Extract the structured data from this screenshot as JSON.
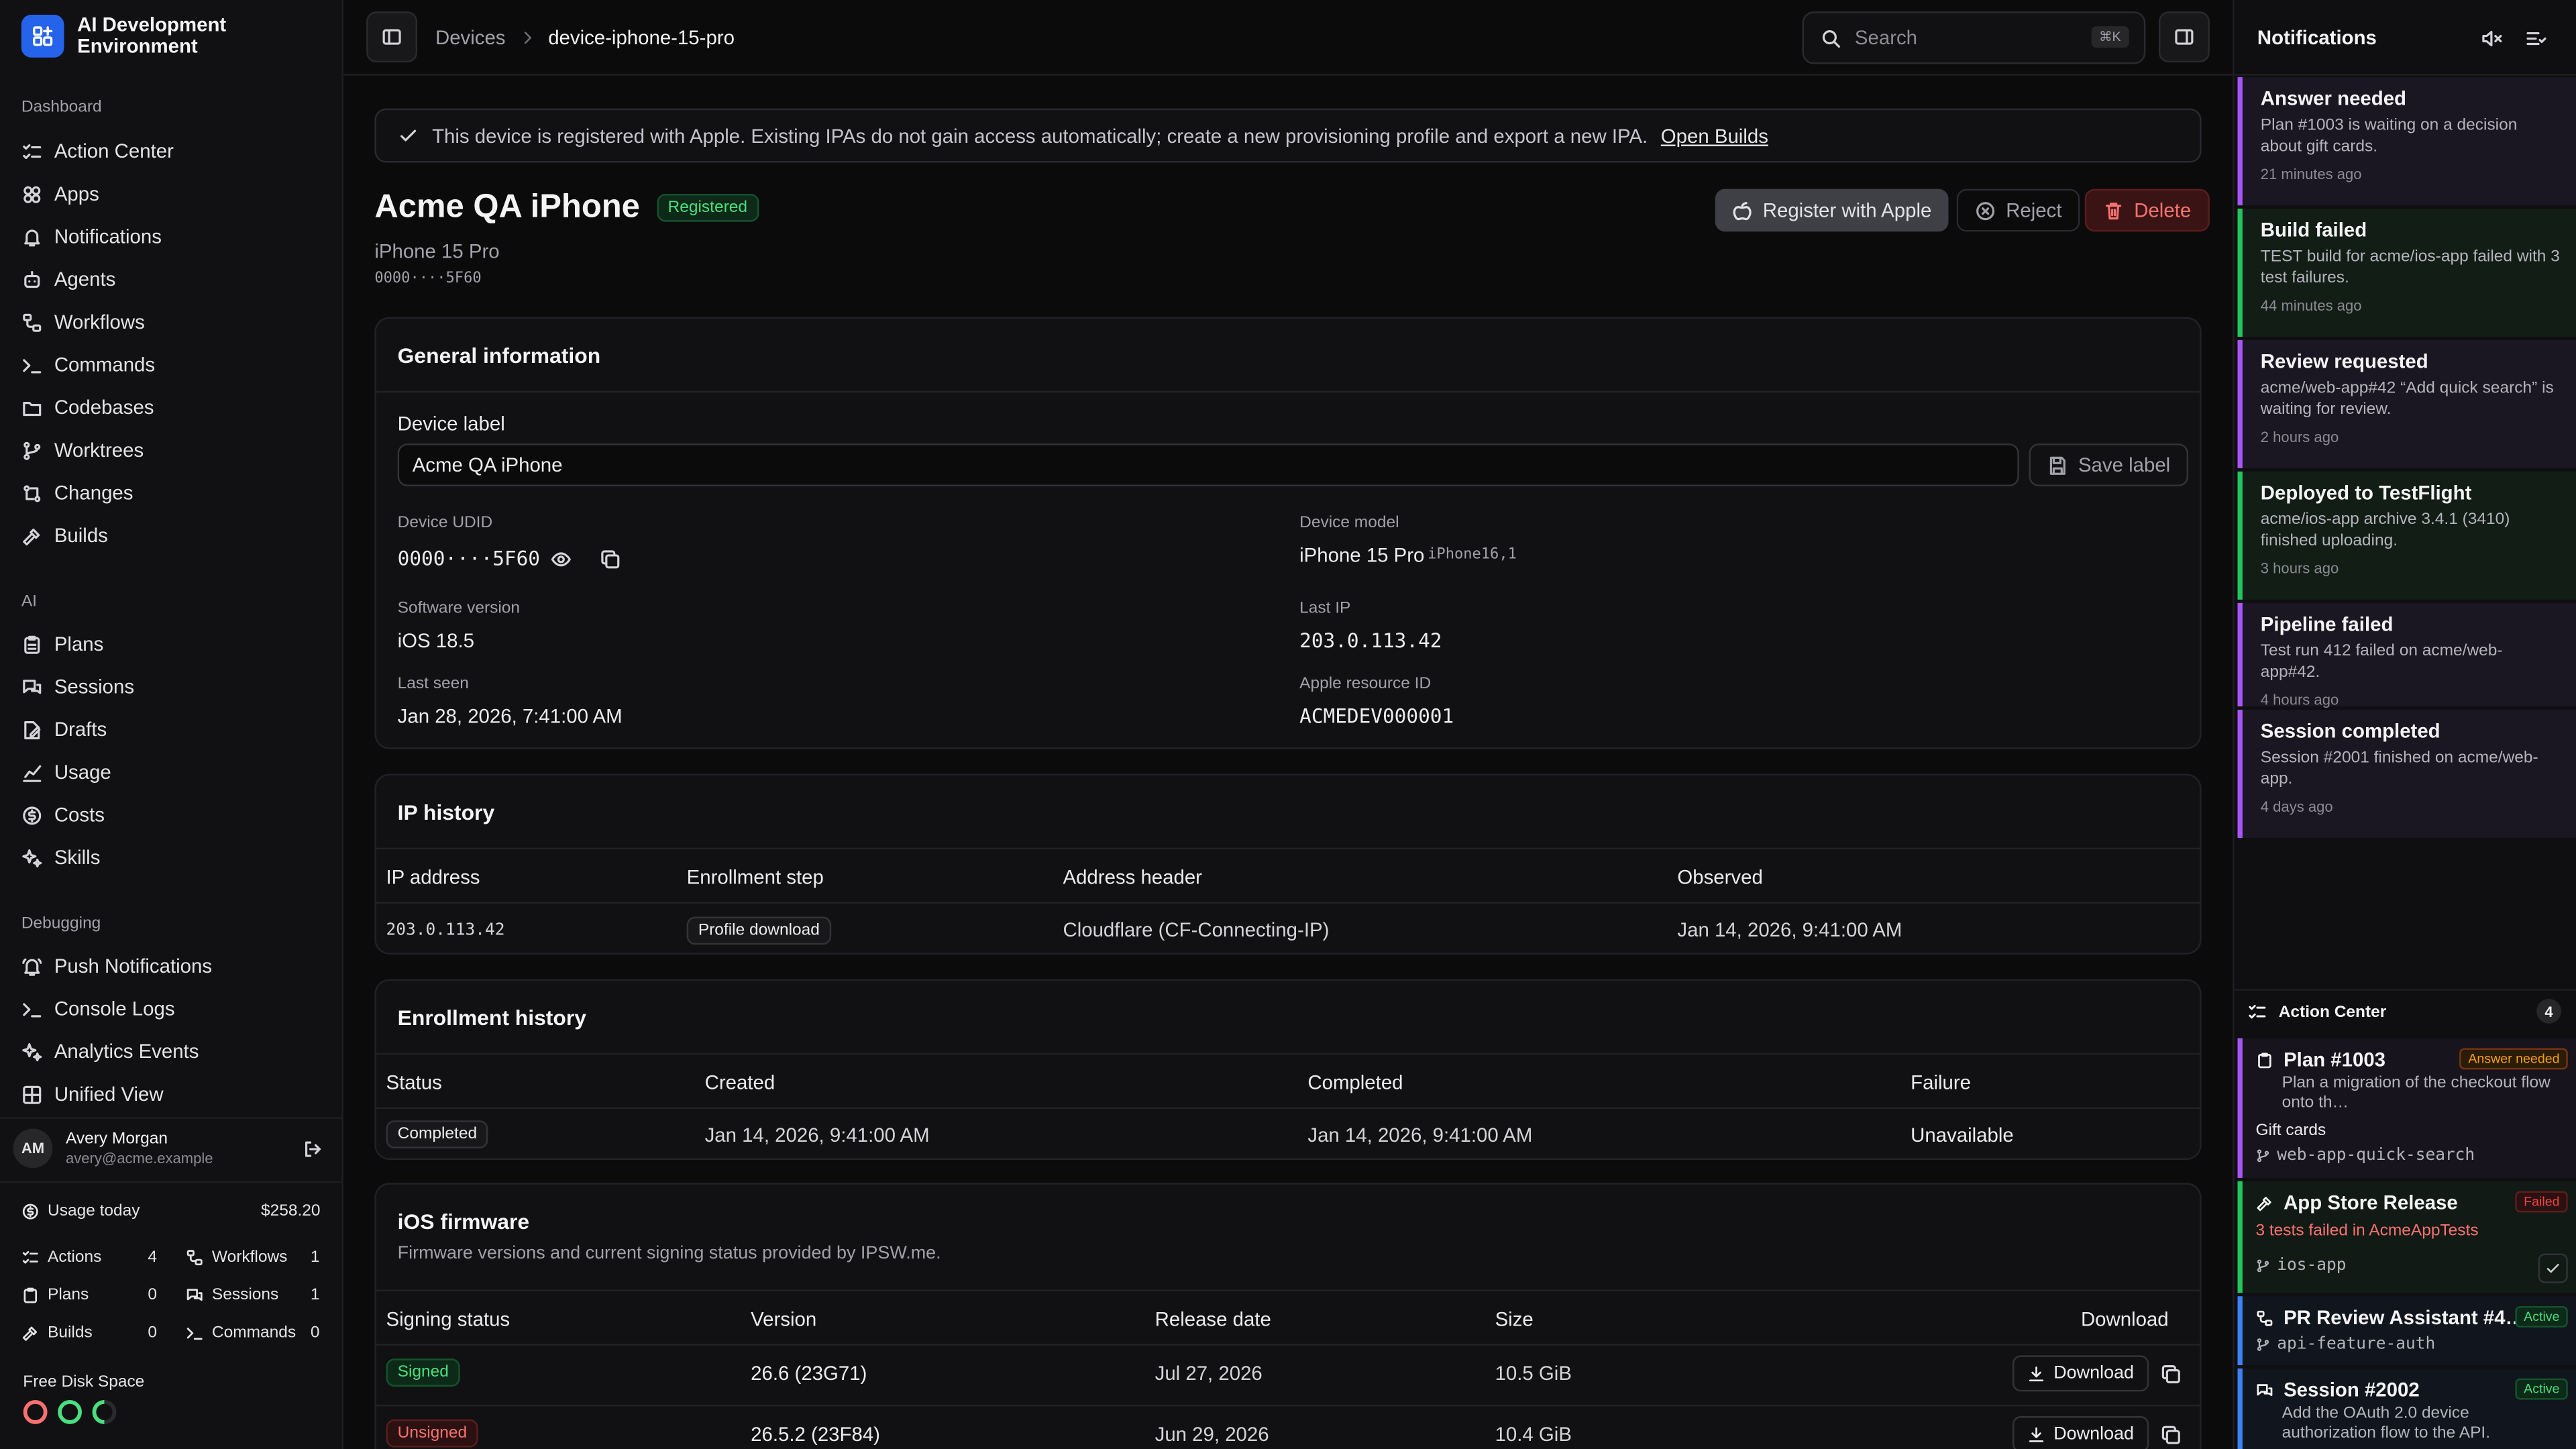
{
  "app": {
    "title": "AI Development Environment"
  },
  "sidebar": {
    "sections": [
      {
        "label": "Dashboard",
        "items": [
          {
            "label": "Action Center",
            "icon": "list-checks-icon"
          },
          {
            "label": "Apps",
            "icon": "apps-icon"
          },
          {
            "label": "Notifications",
            "icon": "bell-icon"
          },
          {
            "label": "Agents",
            "icon": "bot-icon"
          },
          {
            "label": "Workflows",
            "icon": "workflow-icon"
          },
          {
            "label": "Commands",
            "icon": "terminal-icon"
          },
          {
            "label": "Codebases",
            "icon": "folder-code-icon"
          },
          {
            "label": "Worktrees",
            "icon": "git-branch-icon"
          },
          {
            "label": "Changes",
            "icon": "git-compare-icon"
          },
          {
            "label": "Builds",
            "icon": "hammer-icon"
          }
        ]
      },
      {
        "label": "AI",
        "items": [
          {
            "label": "Plans",
            "icon": "clipboard-icon"
          },
          {
            "label": "Sessions",
            "icon": "messages-icon"
          },
          {
            "label": "Drafts",
            "icon": "file-edit-icon"
          },
          {
            "label": "Usage",
            "icon": "chart-icon"
          },
          {
            "label": "Costs",
            "icon": "dollar-circle-icon"
          },
          {
            "label": "Skills",
            "icon": "sparkles-icon"
          }
        ]
      },
      {
        "label": "Debugging",
        "items": [
          {
            "label": "Push Notifications",
            "icon": "bell-ring-icon"
          },
          {
            "label": "Console Logs",
            "icon": "terminal-icon"
          },
          {
            "label": "Analytics Events",
            "icon": "sparkles-icon"
          },
          {
            "label": "Unified View",
            "icon": "layout-grid-icon"
          }
        ]
      }
    ],
    "user": {
      "initials": "AM",
      "name": "Avery Morgan",
      "email": "avery@acme.example"
    },
    "usage": {
      "label": "Usage today",
      "amount": "$258.20",
      "stats": [
        {
          "label": "Actions",
          "value": "4"
        },
        {
          "label": "Workflows",
          "value": "1"
        },
        {
          "label": "Plans",
          "value": "0"
        },
        {
          "label": "Sessions",
          "value": "1"
        },
        {
          "label": "Builds",
          "value": "0"
        },
        {
          "label": "Commands",
          "value": "0"
        }
      ]
    },
    "disk": {
      "label": "Free Disk Space",
      "colors": [
        "#f87171",
        "#4ade80",
        "#4ade80"
      ]
    }
  },
  "topbar": {
    "breadcrumbs": [
      "Devices",
      "device-iphone-15-pro"
    ],
    "search_placeholder": "Search",
    "search_shortcut": "⌘K"
  },
  "alert": {
    "text": "This device is registered with Apple. Existing IPAs do not gain access automatically; create a new provisioning profile and export a new IPA.",
    "link": "Open Builds"
  },
  "device": {
    "name": "Acme QA iPhone",
    "status": "Registered",
    "model": "iPhone 15 Pro",
    "udid_masked": "0000····5F60",
    "actions": {
      "register": "Register with Apple",
      "reject": "Reject",
      "delete": "Delete"
    }
  },
  "general": {
    "title": "General information",
    "label_title": "Device label",
    "label_value": "Acme QA iPhone",
    "save_label": "Save label",
    "udid_label": "Device UDID",
    "udid_value": "0000····5F60",
    "model_label": "Device model",
    "model_value": "iPhone 15 Pro",
    "model_id": "iPhone16,1",
    "sw_label": "Software version",
    "sw_value": "iOS 18.5",
    "ip_label": "Last IP",
    "ip_value": "203.0.113.42",
    "seen_label": "Last seen",
    "seen_value": "Jan 28, 2026, 7:41:00 AM",
    "apple_label": "Apple resource ID",
    "apple_value": "ACMEDEV000001"
  },
  "ip_history": {
    "title": "IP history",
    "columns": [
      "IP address",
      "Enrollment step",
      "Address header",
      "Observed"
    ],
    "rows": [
      {
        "ip": "203.0.113.42",
        "step": "Profile download",
        "header": "Cloudflare (CF-Connecting-IP)",
        "observed": "Jan 14, 2026, 9:41:00 AM"
      }
    ]
  },
  "enrollment": {
    "title": "Enrollment history",
    "columns": [
      "Status",
      "Created",
      "Completed",
      "Failure"
    ],
    "rows": [
      {
        "status": "Completed",
        "created": "Jan 14, 2026, 9:41:00 AM",
        "completed": "Jan 14, 2026, 9:41:00 AM",
        "failure": "Unavailable"
      }
    ]
  },
  "firmware": {
    "title": "iOS firmware",
    "subtitle": "Firmware versions and current signing status provided by IPSW.me.",
    "columns": [
      "Signing status",
      "Version",
      "Release date",
      "Size",
      "Download"
    ],
    "download_label": "Download",
    "rows": [
      {
        "status": "Signed",
        "version": "26.6 (23G71)",
        "date": "Jul 27, 2026",
        "size": "10.5 GiB"
      },
      {
        "status": "Unsigned",
        "version": "26.5.2 (23F84)",
        "date": "Jun 29, 2026",
        "size": "10.4 GiB"
      }
    ]
  },
  "notifications": {
    "title": "Notifications",
    "items": [
      {
        "title": "Answer needed",
        "body": "Plan #1003 is waiting on a decision about gift cards.",
        "time": "21 minutes ago",
        "color": "#a855f7"
      },
      {
        "title": "Build failed",
        "body": "TEST build for acme/ios-app failed with 3 test failures.",
        "time": "44 minutes ago",
        "color": "#22c55e"
      },
      {
        "title": "Review requested",
        "body": "acme/web-app#42 “Add quick search” is waiting for review.",
        "time": "2 hours ago",
        "color": "#a855f7"
      },
      {
        "title": "Deployed to TestFlight",
        "body": "acme/ios-app archive 3.4.1 (3410) finished uploading.",
        "time": "3 hours ago",
        "color": "#22c55e"
      },
      {
        "title": "Pipeline failed",
        "body": "Test run 412 failed on acme/web-app#42.",
        "time": "4 hours ago",
        "color": "#a855f7"
      },
      {
        "title": "Session completed",
        "body": "Session #2001 finished on acme/web-app.",
        "time": "4 days ago",
        "color": "#a855f7"
      }
    ]
  },
  "action_center": {
    "title": "Action Center",
    "count": "4",
    "items": [
      {
        "title": "Plan #1003",
        "tag": "Answer needed",
        "sub": "Plan a migration of the checkout flow onto th…",
        "extra": "Gift cards",
        "branch": "web-app-quick-search",
        "color": "#a855f7",
        "tag_color": "#f59e0b"
      },
      {
        "title": "App Store Release",
        "tag": "Failed",
        "sub": "3 tests failed in AcmeAppTests",
        "branch": "ios-app",
        "color": "#22c55e",
        "tag_color": "#ef4444"
      },
      {
        "title": "PR Review Assistant #4…",
        "tag": "Active",
        "branch": "api-feature-auth",
        "color": "#3b82f6",
        "tag_color": "#22c55e"
      },
      {
        "title": "Session #2002",
        "tag": "Active",
        "sub": "Add the OAuth 2.0 device authorization flow to the API.",
        "color": "#3b82f6",
        "tag_color": "#22c55e"
      }
    ]
  }
}
